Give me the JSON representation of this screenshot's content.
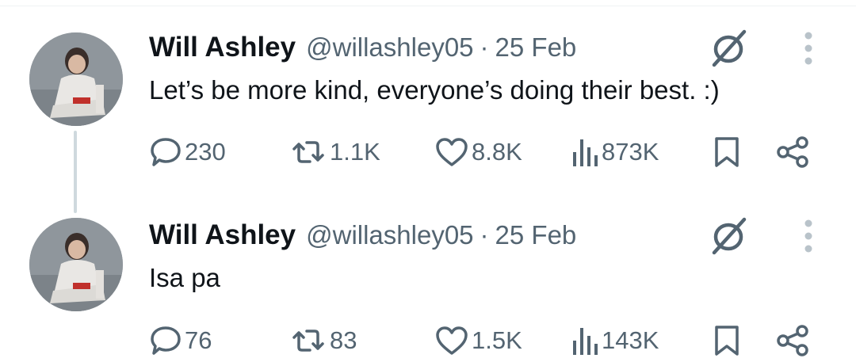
{
  "tweets": [
    {
      "author": {
        "name": "Will Ashley",
        "handle": "@willashley05"
      },
      "separator": "·",
      "date": "25 Feb",
      "text": "Let’s be more kind, everyone’s doing their best. :)",
      "stats": {
        "replies": "230",
        "retweets": "1.1K",
        "likes": "8.8K",
        "views": "873K"
      }
    },
    {
      "author": {
        "name": "Will Ashley",
        "handle": "@willashley05"
      },
      "separator": "·",
      "date": "25 Feb",
      "text": "Isa pa",
      "stats": {
        "replies": "76",
        "retweets": "83",
        "likes": "1.5K",
        "views": "143K"
      }
    }
  ],
  "icons": {
    "grok": "grok-icon",
    "more": "more-vertical-icon",
    "reply": "reply-icon",
    "retweet": "retweet-icon",
    "like": "heart-icon",
    "views": "views-icon",
    "bookmark": "bookmark-icon",
    "share": "share-icon"
  },
  "colors": {
    "text": "#0f1419",
    "secondary": "#536471",
    "thread_line": "#cfd9de"
  }
}
